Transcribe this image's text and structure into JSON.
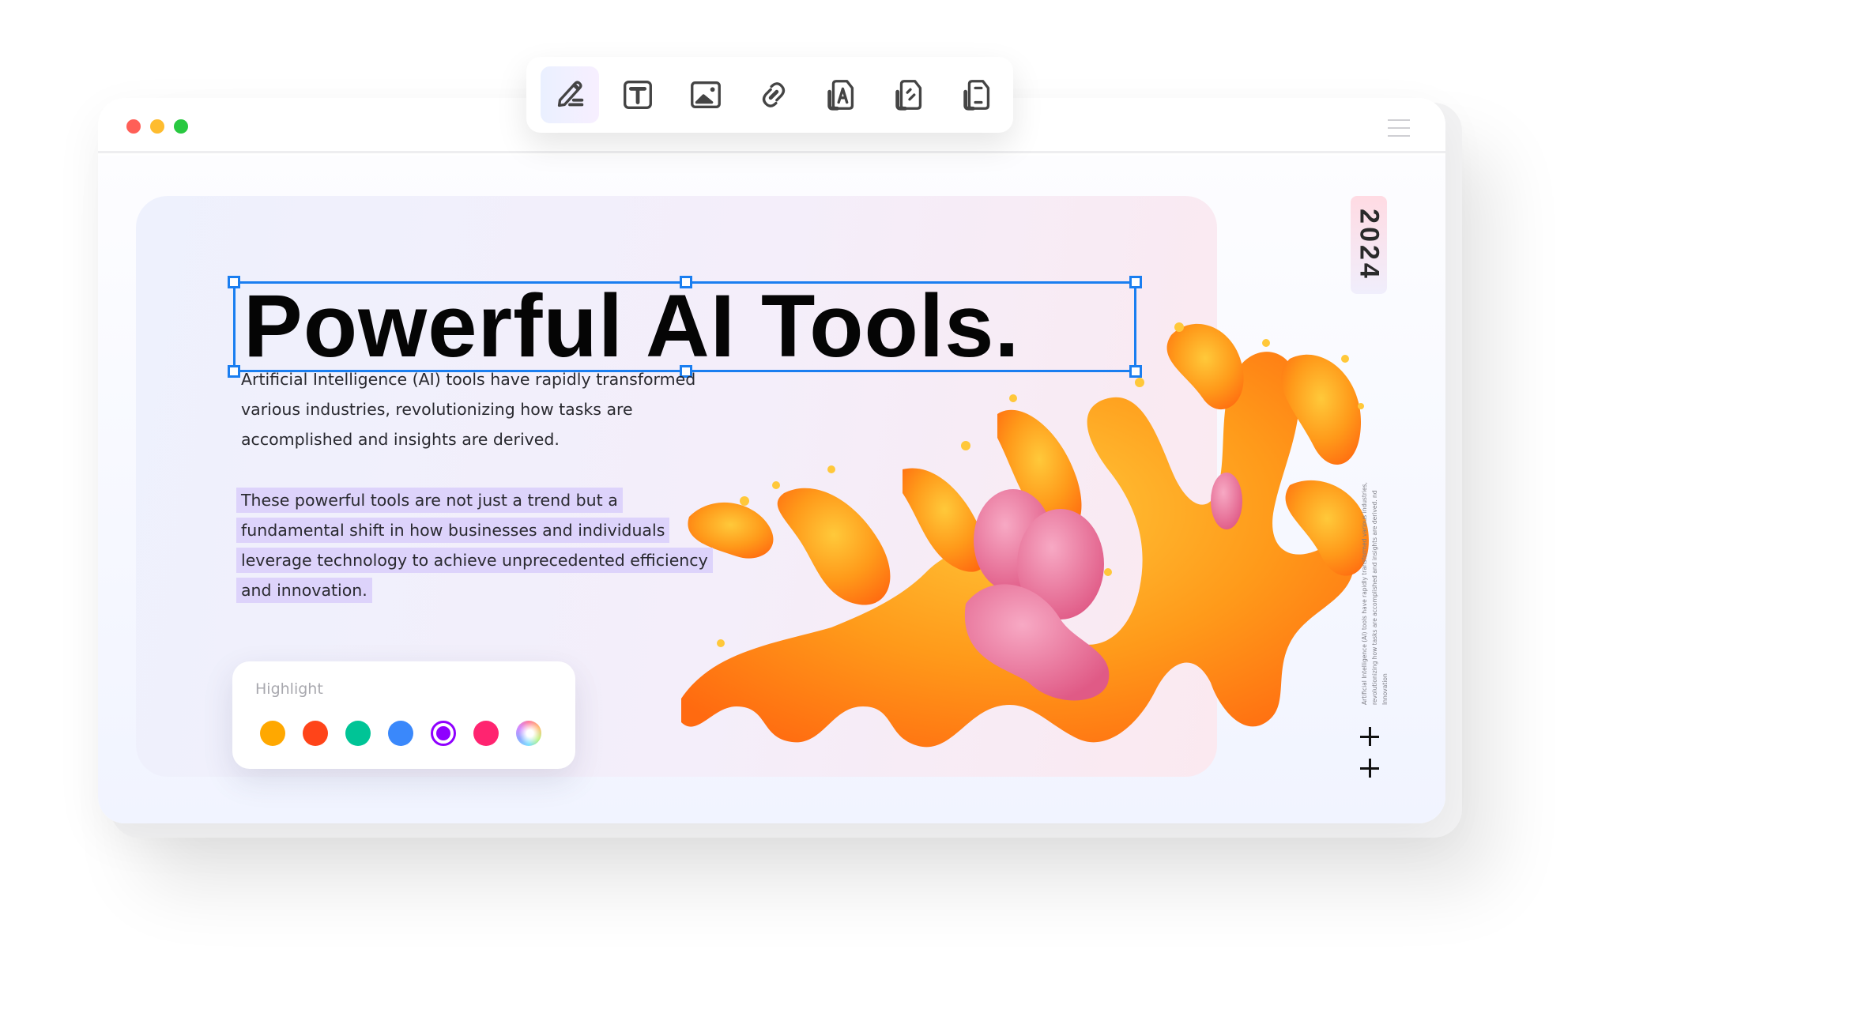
{
  "window": {
    "traffic_lights": [
      "close",
      "minimize",
      "maximize"
    ],
    "menu_icon": "hamburger-menu-icon"
  },
  "toolbar": {
    "tools": [
      {
        "name": "edit-text",
        "icon": "pen-edit-icon",
        "active": true
      },
      {
        "name": "add-text",
        "icon": "text-box-icon",
        "active": false
      },
      {
        "name": "add-image",
        "icon": "image-icon",
        "active": false
      },
      {
        "name": "add-link",
        "icon": "link-icon",
        "active": false
      },
      {
        "name": "watermark",
        "icon": "document-letter-icon",
        "active": false
      },
      {
        "name": "annotate",
        "icon": "document-pen-icon",
        "active": false
      },
      {
        "name": "header-footer",
        "icon": "document-header-footer-icon",
        "active": false
      }
    ]
  },
  "hero": {
    "title": "Powerful AI Tools.",
    "paragraph_1": "Artificial Intelligence (AI) tools have rapidly transformed various industries, revolutionizing how tasks are accomplished and insights are derived.",
    "paragraph_2_lines": [
      "These powerful tools are not just a trend but a",
      "fundamental shift in how businesses and individuals",
      "leverage technology to achieve unprecedented efficiency",
      "and innovation."
    ],
    "paragraph_2_highlight_color": "#ddd3fb"
  },
  "highlight_panel": {
    "label": "Highlight",
    "colors": [
      {
        "name": "orange",
        "hex": "#ffa800"
      },
      {
        "name": "red-orange",
        "hex": "#ff4419"
      },
      {
        "name": "green",
        "hex": "#00c496"
      },
      {
        "name": "blue",
        "hex": "#3a88fb"
      },
      {
        "name": "purple",
        "hex": "#8f00ff",
        "selected": true
      },
      {
        "name": "pink",
        "hex": "#ff2470"
      },
      {
        "name": "custom",
        "hex": "rainbow"
      }
    ]
  },
  "sidebar": {
    "year": "2024",
    "vertical_text": "Artificial Intelligence (AI) tools have rapidly transformed various industries, revolutionizing how tasks are accomplished and insights are derived. nd Innovation"
  },
  "colors": {
    "selection": "#1a7ef0",
    "title": "#050505",
    "body_text": "#2a2a30"
  }
}
